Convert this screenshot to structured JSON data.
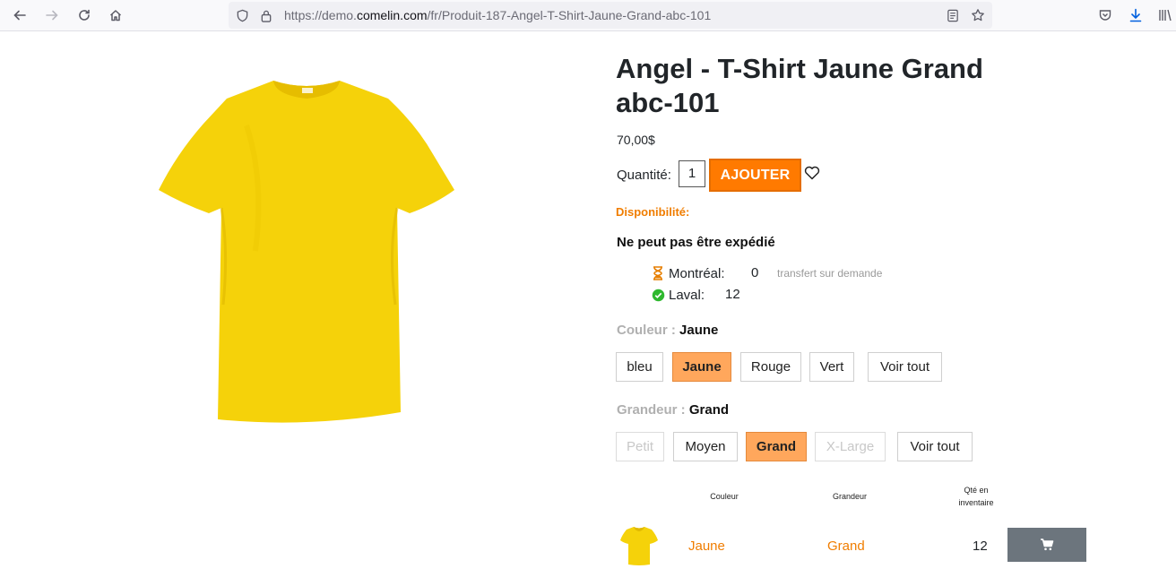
{
  "browser": {
    "url_prefix": "https://demo.",
    "url_domain": "comelin.com",
    "url_path": "/fr/Produit-187-Angel-T-Shirt-Jaune-Grand-abc-101"
  },
  "product": {
    "title": "Angel - T-Shirt Jaune Grand abc-101",
    "price": "70,00$",
    "quantity_label": "Quantité:",
    "quantity_value": "1",
    "add_button": "AJOUTER",
    "availability_label": "Disponibilité:",
    "shipping_status": "Ne peut pas être expédié",
    "stores": [
      {
        "name": "Montréal:",
        "qty": "0",
        "note": "transfert sur demande",
        "status_icon": "hourglass-icon"
      },
      {
        "name": "Laval:",
        "qty": "12",
        "status_icon": "check-circle-icon"
      }
    ]
  },
  "options": {
    "color": {
      "label": "Couleur :",
      "selected": "Jaune",
      "choices": [
        "bleu",
        "Jaune",
        "Rouge",
        "Vert",
        "Voir tout"
      ]
    },
    "size": {
      "label": "Grandeur :",
      "selected": "Grand",
      "choices": [
        "Petit",
        "Moyen",
        "Grand",
        "X-Large",
        "Voir tout"
      ]
    }
  },
  "variants_table": {
    "headers": {
      "color": "Couleur",
      "size": "Grandeur",
      "qty": "Qté en inventaire"
    },
    "rows": [
      {
        "color": "Jaune",
        "size": "Grand",
        "qty": "12"
      }
    ]
  },
  "colors": {
    "accent": "#ff7a00",
    "accent_text": "#f07d00",
    "active_option": "#ffa75c",
    "cart_button": "#6c757d",
    "tshirt": "#f5d20a"
  }
}
